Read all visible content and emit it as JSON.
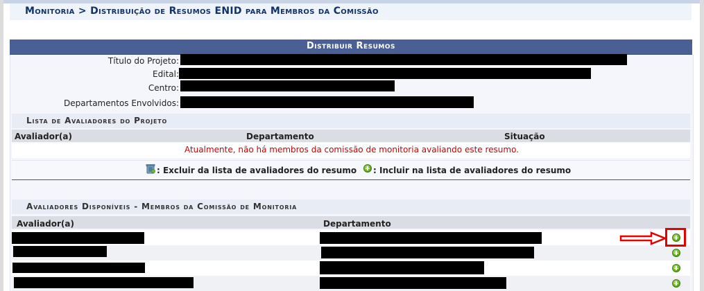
{
  "breadcrumb": "Monitoria > Distribuição de Resumos ENID para Membros da Comissão",
  "form": {
    "title": "Distribuir Resumos",
    "fields": [
      {
        "label": "Título do Projeto:"
      },
      {
        "label": "Edital:"
      },
      {
        "label": "Centro:"
      },
      {
        "label": "Departamentos Envolvidos:"
      }
    ]
  },
  "project_evaluators": {
    "caption": "Lista de Avaliadores do Projeto",
    "columns": [
      "Avaliador(a)",
      "Departamento",
      "Situação"
    ],
    "empty_message": "Atualmente, não há membros da comissão de monitoria avaliando este resumo."
  },
  "legend": {
    "remove_label": ": Excluir da lista de avaliadores do resumo",
    "add_label": ": Incluir na lista de avaliadores do resumo"
  },
  "available_evaluators": {
    "caption": "Avaliadores Disponíveis - Membros da Comissão de Monitoria",
    "columns": [
      "Avaliador(a)",
      "Departamento"
    ]
  },
  "colors": {
    "header_blue": "#4a5f93",
    "breadcrumb_text": "#10336e",
    "error_red": "#cc0000",
    "highlight_red": "#e60000",
    "add_green": "#59a617"
  },
  "icons": [
    "trash-icon",
    "plus-circle-icon",
    "arrow-right-icon"
  ]
}
